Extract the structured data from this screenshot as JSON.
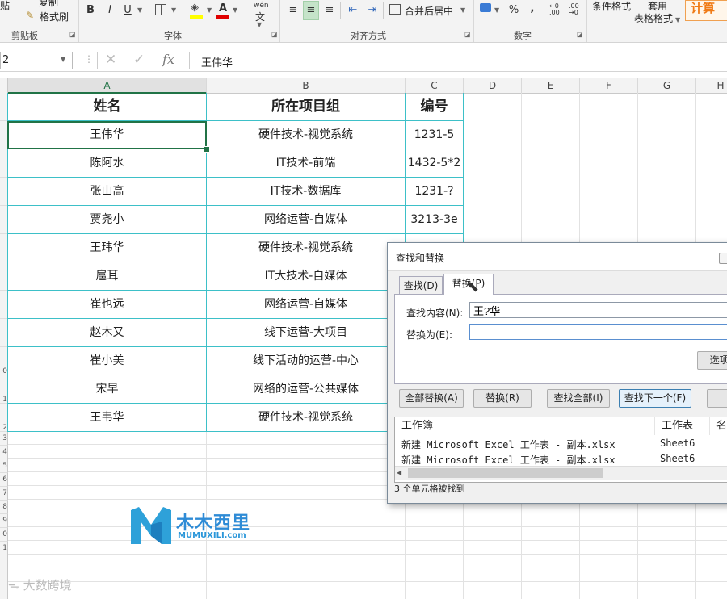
{
  "ribbon": {
    "clipboard": {
      "paste_label": "贴",
      "copy_label": "复制",
      "format_painter_label": "格式刷",
      "group_label": "剪贴板"
    },
    "font": {
      "bold": "B",
      "italic": "I",
      "underline": "U",
      "font_color_letter": "A",
      "wen": "wén",
      "group_label": "字体"
    },
    "align": {
      "merge_label": "合并后居中",
      "group_label": "对齐方式"
    },
    "number": {
      "percent": "%",
      "comma": ",",
      "group_label": "数字"
    },
    "styles": {
      "conditional_format": "条件格式",
      "table_format_1": "套用",
      "table_format_2": "表格格式",
      "calc": "计算"
    }
  },
  "formula_bar": {
    "name_box": "2",
    "formula_value": "王伟华",
    "fx": "fx"
  },
  "columns": [
    "A",
    "B",
    "C",
    "D",
    "E",
    "F",
    "G",
    "H"
  ],
  "row_numbers": [
    "",
    "",
    "",
    "",
    "",
    "",
    "",
    "",
    "",
    "0",
    "1",
    "2",
    "3",
    "4",
    "5",
    "6",
    "7",
    "8",
    "9",
    "0",
    "1"
  ],
  "table": {
    "headers": [
      "姓名",
      "所在项目组",
      "编号"
    ],
    "rows": [
      [
        "王伟华",
        "硬件技术-视觉系统",
        "1231-5"
      ],
      [
        "陈阿水",
        "IT技术-前端",
        "1432-5*2"
      ],
      [
        "张山高",
        "IT技术-数据库",
        "1231-?"
      ],
      [
        "贾尧小",
        "网络运营-自媒体",
        "3213-3e"
      ],
      [
        "王玮华",
        "硬件技术-视觉系统",
        ""
      ],
      [
        "扈耳",
        "IT大技术-自媒体",
        ""
      ],
      [
        "崔也远",
        "网络运营-自媒体",
        ""
      ],
      [
        "赵木又",
        "线下运营-大项目",
        ""
      ],
      [
        "崔小美",
        "线下活动的运营-中心",
        ""
      ],
      [
        "宋早",
        "网络的运营-公共媒体",
        ""
      ],
      [
        "王韦华",
        "硬件技术-视觉系统",
        ""
      ]
    ]
  },
  "dialog": {
    "title": "查找和替换",
    "tabs": [
      "查找(D)",
      "替换(P)"
    ],
    "find_label": "查找内容(N):",
    "find_value": "王?华",
    "replace_label": "替换为(E):",
    "replace_value": "",
    "options_button": "选项(",
    "buttons": [
      "全部替换(A)",
      "替换(R)",
      "查找全部(I)",
      "查找下一个(F)"
    ],
    "result_headers": [
      "工作簿",
      "工作表",
      "名"
    ],
    "results": [
      [
        "新建 Microsoft Excel 工作表 - 副本.xlsx",
        "Sheet6"
      ],
      [
        "新建 Microsoft Excel 工作表 - 副本.xlsx",
        "Sheet6"
      ]
    ],
    "status": "3 个单元格被找到"
  },
  "watermark": {
    "brand": "木木西里",
    "domain": "MUMUXILI.com",
    "second": "大数跨境"
  },
  "colors": {
    "accent_green": "#217346",
    "border_cyan": "#3dc0c8",
    "brand_blue": "#2e8bd6"
  }
}
